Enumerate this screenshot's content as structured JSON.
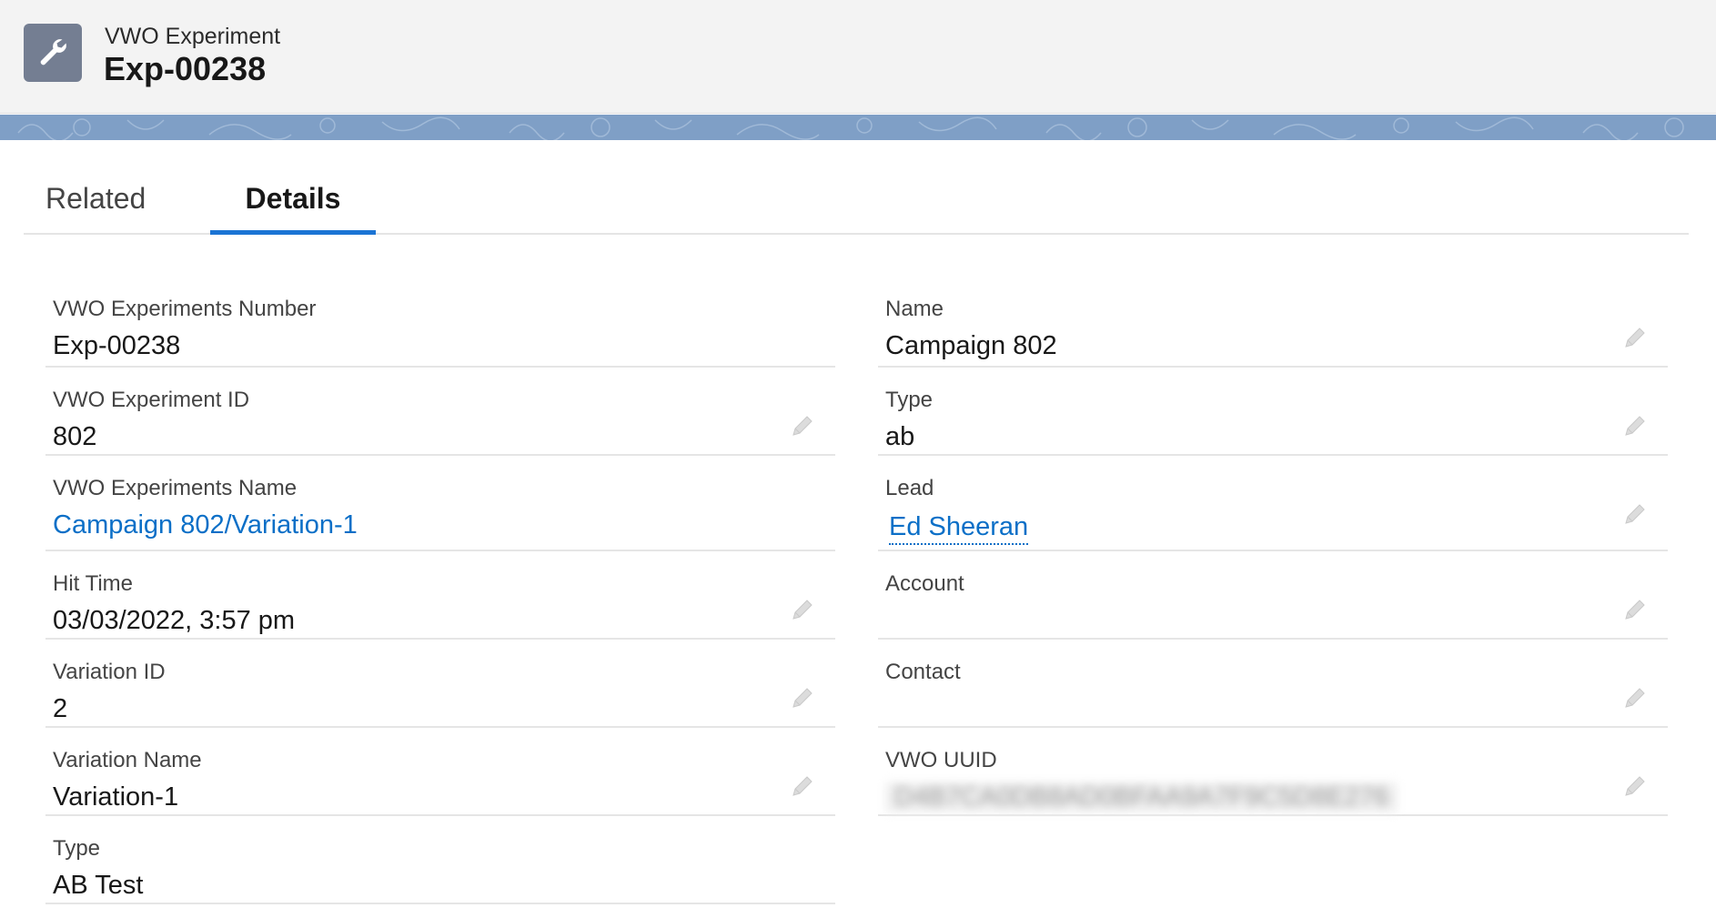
{
  "header": {
    "object_label": "VWO Experiment",
    "record_title": "Exp-00238",
    "icon": "wrench-icon"
  },
  "tabs": [
    {
      "label": "Related",
      "active": false
    },
    {
      "label": "Details",
      "active": true
    }
  ],
  "fields_left": [
    {
      "label": "VWO Experiments Number",
      "value": "Exp-00238",
      "editable": false
    },
    {
      "label": "VWO Experiment ID",
      "value": "802",
      "editable": true
    },
    {
      "label": "VWO Experiments Name",
      "value": "Campaign 802/Variation-1",
      "editable": false,
      "link": true
    },
    {
      "label": "Hit Time",
      "value": "03/03/2022, 3:57 pm",
      "editable": true
    },
    {
      "label": "Variation ID",
      "value": "2",
      "editable": true
    },
    {
      "label": "Variation Name",
      "value": "Variation-1",
      "editable": true
    },
    {
      "label": "Type",
      "value": "AB Test",
      "editable": false
    }
  ],
  "fields_right": [
    {
      "label": "Name",
      "value": "Campaign 802",
      "editable": true
    },
    {
      "label": "Type",
      "value": "ab",
      "editable": true
    },
    {
      "label": "Lead",
      "value": "Ed Sheeran",
      "editable": true,
      "link": true
    },
    {
      "label": "Account",
      "value": "",
      "editable": true
    },
    {
      "label": "Contact",
      "value": "",
      "editable": true
    },
    {
      "label": "VWO UUID",
      "value": "D4B7CA0DB8AD0BFAA9A7F9C5D8E276",
      "editable": true,
      "blurred": true
    }
  ],
  "colors": {
    "link": "#0b6fc7",
    "tab_indicator": "#1b74d4",
    "header_icon_bg": "#747e92",
    "band": "#7f9fc6"
  }
}
